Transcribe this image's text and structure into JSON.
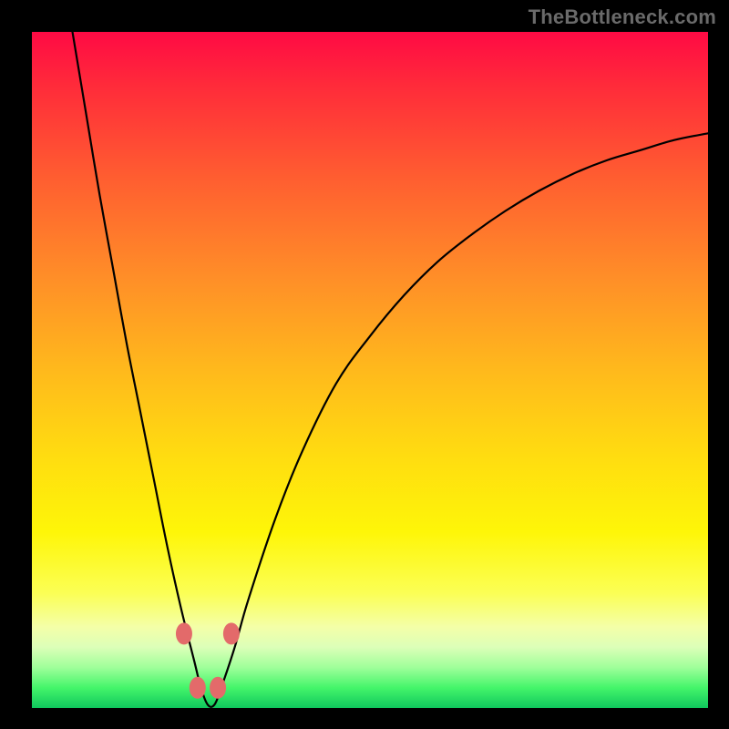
{
  "watermark": "TheBottleneck.com",
  "chart_data": {
    "type": "line",
    "title": "",
    "xlabel": "",
    "ylabel": "",
    "xlim": [
      0,
      100
    ],
    "ylim": [
      0,
      100
    ],
    "grid": false,
    "legend": false,
    "background_gradient": {
      "top_color": "#ff0a44",
      "bottom_color": "#0fc75d"
    },
    "series": [
      {
        "name": "bottleneck-curve",
        "color": "#000000",
        "x": [
          6,
          8,
          10,
          12,
          14,
          16,
          18,
          20,
          22,
          24,
          25,
          26,
          27,
          28,
          30,
          32,
          36,
          40,
          45,
          50,
          55,
          60,
          65,
          70,
          75,
          80,
          85,
          90,
          95,
          100
        ],
        "y": [
          100,
          88,
          76,
          65,
          54,
          44,
          34,
          24,
          15,
          7,
          3,
          0.5,
          0.5,
          3,
          9,
          16,
          28,
          38,
          48,
          55,
          61,
          66,
          70,
          73.5,
          76.5,
          79,
          81,
          82.5,
          84,
          85
        ]
      }
    ],
    "markers": {
      "name": "highlight-dots",
      "color": "#e36a6a",
      "points": [
        {
          "x": 22.5,
          "y": 11
        },
        {
          "x": 24.5,
          "y": 3
        },
        {
          "x": 27.5,
          "y": 3
        },
        {
          "x": 29.5,
          "y": 11
        }
      ]
    }
  }
}
